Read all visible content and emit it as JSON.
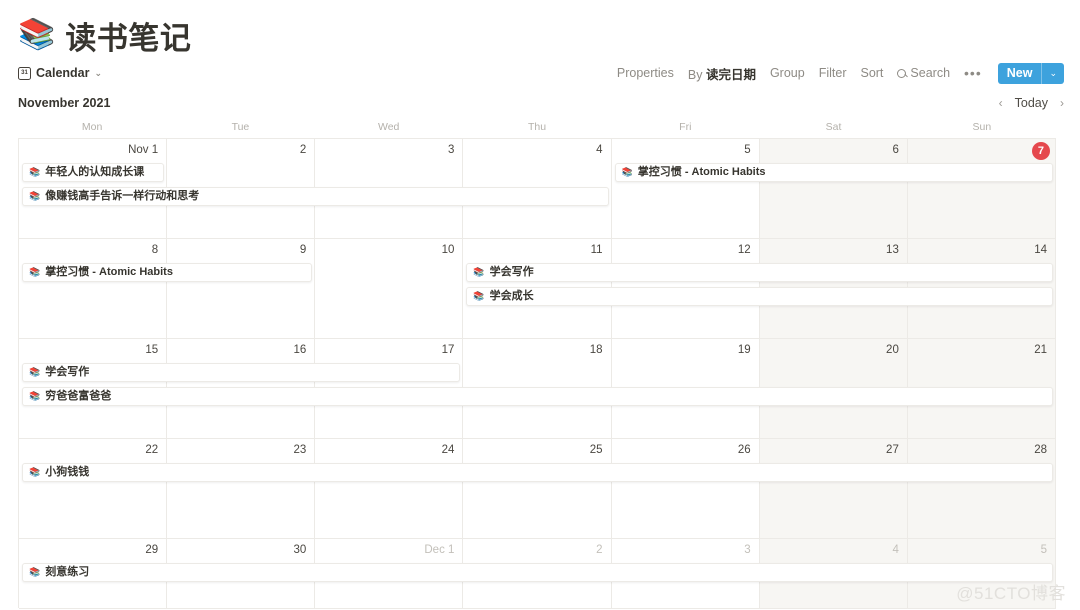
{
  "page": {
    "emoji": "📚",
    "emoji_name": "books-emoji",
    "title": "读书笔记"
  },
  "view_tab": {
    "icon": "calendar-icon",
    "icon_text": "31",
    "label": "Calendar",
    "chevron": "⌄"
  },
  "toolbar": {
    "properties": "Properties",
    "sort_by_prefix": "By ",
    "sort_by_value": "读完日期",
    "group": "Group",
    "filter": "Filter",
    "sort": "Sort",
    "search": "Search",
    "more": "•••",
    "new_label": "New",
    "new_caret": "⌄",
    "accent_color": "#3da2dd"
  },
  "month_bar": {
    "month": "November 2021",
    "prev": "‹",
    "today": "Today",
    "next": "›"
  },
  "weekdays": [
    "Mon",
    "Tue",
    "Wed",
    "Thu",
    "Fri",
    "Sat",
    "Sun"
  ],
  "today_color": "#e5484d",
  "weeks": [
    {
      "days": [
        {
          "label": "Nov 1",
          "muted": false,
          "weekend": false,
          "today": false
        },
        {
          "label": "2",
          "muted": false,
          "weekend": false,
          "today": false
        },
        {
          "label": "3",
          "muted": false,
          "weekend": false,
          "today": false
        },
        {
          "label": "4",
          "muted": false,
          "weekend": false,
          "today": false
        },
        {
          "label": "5",
          "muted": false,
          "weekend": false,
          "today": false
        },
        {
          "label": "6",
          "muted": false,
          "weekend": true,
          "today": false
        },
        {
          "label": "7",
          "muted": false,
          "weekend": true,
          "today": true
        }
      ],
      "events": [
        {
          "title": "年轻人的认知成长课",
          "emoji": "📚",
          "start": 0,
          "span": 1,
          "lane": 0
        },
        {
          "title": "像赚钱高手告诉一样行动和思考",
          "emoji": "📚",
          "start": 0,
          "span": 4,
          "lane": 1
        },
        {
          "title": "掌控习惯 - Atomic Habits",
          "emoji": "📚",
          "start": 4,
          "span": 3,
          "lane": 0
        }
      ]
    },
    {
      "days": [
        {
          "label": "8",
          "muted": false,
          "weekend": false,
          "today": false
        },
        {
          "label": "9",
          "muted": false,
          "weekend": false,
          "today": false
        },
        {
          "label": "10",
          "muted": false,
          "weekend": false,
          "today": false
        },
        {
          "label": "11",
          "muted": false,
          "weekend": false,
          "today": false
        },
        {
          "label": "12",
          "muted": false,
          "weekend": false,
          "today": false
        },
        {
          "label": "13",
          "muted": false,
          "weekend": true,
          "today": false
        },
        {
          "label": "14",
          "muted": false,
          "weekend": true,
          "today": false
        }
      ],
      "events": [
        {
          "title": "掌控习惯 - Atomic Habits",
          "emoji": "📚",
          "start": 0,
          "span": 2,
          "lane": 0
        },
        {
          "title": "学会写作",
          "emoji": "📚",
          "start": 3,
          "span": 4,
          "lane": 0
        },
        {
          "title": "学会成长",
          "emoji": "📚",
          "start": 3,
          "span": 4,
          "lane": 1
        }
      ]
    },
    {
      "days": [
        {
          "label": "15",
          "muted": false,
          "weekend": false,
          "today": false
        },
        {
          "label": "16",
          "muted": false,
          "weekend": false,
          "today": false
        },
        {
          "label": "17",
          "muted": false,
          "weekend": false,
          "today": false
        },
        {
          "label": "18",
          "muted": false,
          "weekend": false,
          "today": false
        },
        {
          "label": "19",
          "muted": false,
          "weekend": false,
          "today": false
        },
        {
          "label": "20",
          "muted": false,
          "weekend": true,
          "today": false
        },
        {
          "label": "21",
          "muted": false,
          "weekend": true,
          "today": false
        }
      ],
      "events": [
        {
          "title": "学会写作",
          "emoji": "📚",
          "start": 0,
          "span": 3,
          "lane": 0
        },
        {
          "title": "穷爸爸富爸爸",
          "emoji": "📚",
          "start": 0,
          "span": 7,
          "lane": 1
        }
      ]
    },
    {
      "days": [
        {
          "label": "22",
          "muted": false,
          "weekend": false,
          "today": false
        },
        {
          "label": "23",
          "muted": false,
          "weekend": false,
          "today": false
        },
        {
          "label": "24",
          "muted": false,
          "weekend": false,
          "today": false
        },
        {
          "label": "25",
          "muted": false,
          "weekend": false,
          "today": false
        },
        {
          "label": "26",
          "muted": false,
          "weekend": false,
          "today": false
        },
        {
          "label": "27",
          "muted": false,
          "weekend": true,
          "today": false
        },
        {
          "label": "28",
          "muted": false,
          "weekend": true,
          "today": false
        }
      ],
      "events": [
        {
          "title": "小狗钱钱",
          "emoji": "📚",
          "start": 0,
          "span": 7,
          "lane": 0
        }
      ]
    },
    {
      "days": [
        {
          "label": "29",
          "muted": false,
          "weekend": false,
          "today": false
        },
        {
          "label": "30",
          "muted": false,
          "weekend": false,
          "today": false
        },
        {
          "label": "Dec 1",
          "muted": true,
          "weekend": false,
          "today": false
        },
        {
          "label": "2",
          "muted": true,
          "weekend": false,
          "today": false
        },
        {
          "label": "3",
          "muted": true,
          "weekend": false,
          "today": false
        },
        {
          "label": "4",
          "muted": true,
          "weekend": true,
          "today": false
        },
        {
          "label": "5",
          "muted": true,
          "weekend": true,
          "today": false
        }
      ],
      "events": [
        {
          "title": "刻意练习",
          "emoji": "📚",
          "start": 0,
          "span": 7,
          "lane": 0
        }
      ]
    }
  ],
  "watermark": "@51CTO博客"
}
